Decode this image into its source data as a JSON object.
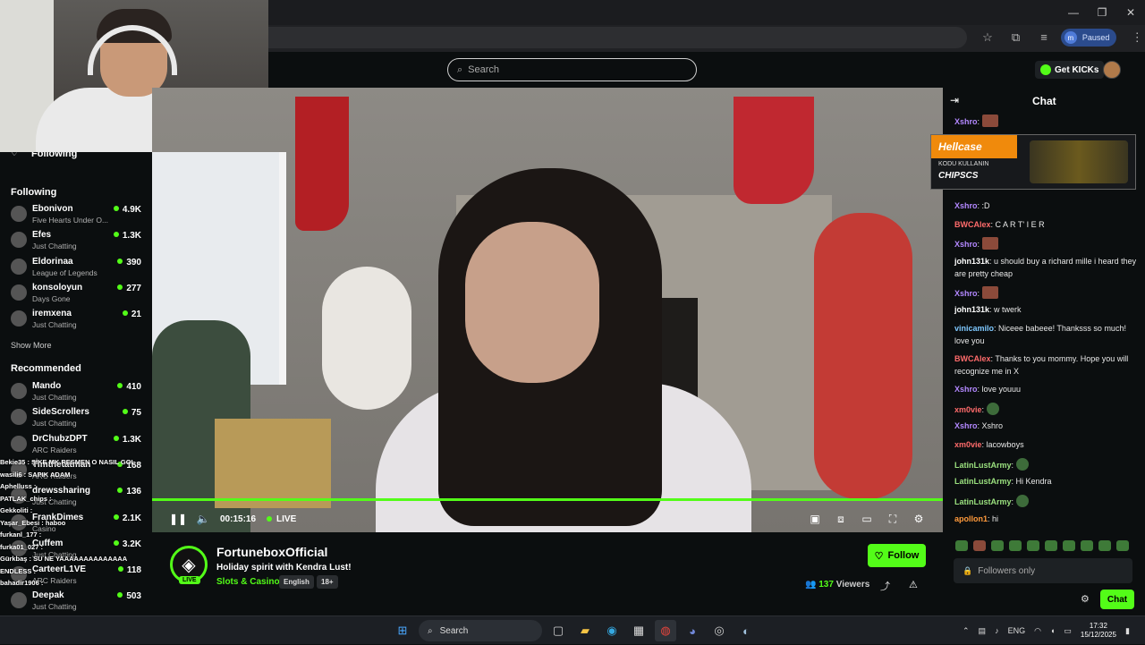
{
  "browser": {
    "window_controls": [
      "—",
      "❐",
      "✕"
    ],
    "profile_initial": "m",
    "profile_status": "Paused"
  },
  "topnav": {
    "search_placeholder": "Search",
    "get_kicks_label": "Get KICKs"
  },
  "sidebar": {
    "following_tab": "Following",
    "following_header": "Following",
    "following": [
      {
        "name": "Ebonivon",
        "category": "Five Hearts Under O...",
        "viewers": "4.9K"
      },
      {
        "name": "Efes",
        "category": "Just Chatting",
        "viewers": "1.3K"
      },
      {
        "name": "Eldorinaa",
        "category": "League of Legends",
        "viewers": "390"
      },
      {
        "name": "konsoloyun",
        "category": "Days Gone",
        "viewers": "277"
      },
      {
        "name": "iremxena",
        "category": "Just Chatting",
        "viewers": "21"
      }
    ],
    "show_more": "Show More",
    "recommended_header": "Recommended",
    "recommended": [
      {
        "name": "Mando",
        "category": "Just Chatting",
        "viewers": "410"
      },
      {
        "name": "SideScrollers",
        "category": "Just Chatting",
        "viewers": "75"
      },
      {
        "name": "DrChubzDPT",
        "category": "ARC Raiders",
        "viewers": "1.3K"
      },
      {
        "name": "Timthetatman",
        "category": "ARC Raiders",
        "viewers": "168"
      },
      {
        "name": "drewssharing",
        "category": "Just Chatting",
        "viewers": "136"
      },
      {
        "name": "FrankDimes",
        "category": "Casino",
        "viewers": "2.1K"
      },
      {
        "name": "Cuffem",
        "category": "Just Chatting",
        "viewers": "3.2K"
      },
      {
        "name": "CarteerL1VE",
        "category": "ARC Raiders",
        "viewers": "118"
      },
      {
        "name": "Deepak",
        "category": "Just Chatting",
        "viewers": "503"
      }
    ],
    "overlay_chat": [
      "Bekie35 : ŞİKE MK RESMEN O NASIL GOL",
      "wasili6 : SAPIK ADAM",
      "Aphelluss : ",
      "PATLAK_chips : ",
      "Gekkoliti : ",
      "Yaşar_Ebesi : haboo",
      "furkanl_177 : ",
      "furka01_027 : ",
      "Gürkbaş : SU NE YAAAAAAAAAAAAAA",
      "ENDLESS : ",
      "bahadir1906 : "
    ]
  },
  "video": {
    "progress": 1.0,
    "time": "00:15:16",
    "live_label": "LIVE"
  },
  "stream": {
    "channel": "FortuneboxOfficial",
    "live_badge": "LIVE",
    "title": "Holiday spirit with Kendra Lust!",
    "category": "Slots & Casino",
    "tags": [
      "English",
      "18+"
    ],
    "follow_label": "Follow",
    "viewers_count": "137",
    "viewers_label": "Viewers"
  },
  "chat": {
    "title": "Chat",
    "promo": {
      "brand": "Hellcase",
      "line1": "KODU KULLANIN",
      "line2": "CHIPSCS"
    },
    "messages": [
      {
        "user": "Xshro",
        "color": "#b388ff",
        "text": "",
        "emote": "red"
      },
      {
        "user": "Xshro",
        "color": "#b388ff",
        "text": "ok"
      },
      {
        "user": "Xshro",
        "color": "#b388ff",
        "text": ":D"
      },
      {
        "user": "BWCAlex",
        "color": "#ff6b6b",
        "text": "C A R T' I E R"
      },
      {
        "user": "Xshro",
        "color": "#b388ff",
        "text": "",
        "emote": "red"
      },
      {
        "user": "john131k",
        "color": "#ffffff",
        "text": "u should buy a richard mille i heard they are pretty cheap"
      },
      {
        "user": "Xshro",
        "color": "#b388ff",
        "text": "",
        "emote": "red"
      },
      {
        "user": "john131k",
        "color": "#ffffff",
        "text": "w twerk"
      },
      {
        "user": "vinicamilo",
        "color": "#7ec8ff",
        "text": "Niceee babeee! Thanksss so much! love you"
      },
      {
        "user": "BWCAlex",
        "color": "#ff6b6b",
        "text": "Thanks to you mommy. Hope you will recognize me in X"
      },
      {
        "user": "Xshro",
        "color": "#b388ff",
        "text": "love youuu"
      },
      {
        "user": "xm0vie",
        "color": "#ff6b6b",
        "text": "",
        "emote": "green"
      },
      {
        "user": "Xshro",
        "color": "#b388ff",
        "text": "Xshro"
      },
      {
        "user": "xm0vie",
        "color": "#ff6b6b",
        "text": "lacowboys"
      },
      {
        "user": "LatinLustArmy",
        "color": "#9be17f",
        "text": "",
        "emote": "green"
      },
      {
        "user": "LatinLustArmy",
        "color": "#9be17f",
        "text": "Hi Kendra"
      },
      {
        "user": "LatinLustArmy",
        "color": "#9be17f",
        "text": "",
        "emote": "green"
      },
      {
        "user": "apollon1",
        "color": "#ff9a3c",
        "text": "hi"
      }
    ],
    "input_placeholder": "Followers only",
    "send_label": "Chat"
  },
  "taskbar": {
    "search_label": "Search",
    "lang": "ENG",
    "time": "17:32",
    "date": "15/12/2025"
  }
}
